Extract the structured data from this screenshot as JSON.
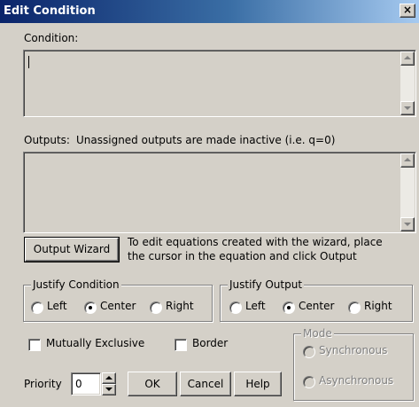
{
  "window": {
    "title": "Edit Condition",
    "close_glyph": "×"
  },
  "condition": {
    "label": "Condition:",
    "value": ""
  },
  "outputs": {
    "label": "Outputs:",
    "note": "Unassigned outputs are made inactive (i.e. q=0)",
    "value": ""
  },
  "wizard": {
    "button_label": "Output Wizard",
    "help_line1": "To edit equations created with the wizard, place",
    "help_line2": "the cursor in the equation and click Output"
  },
  "justify_condition": {
    "legend": "Justify Condition",
    "options": [
      "Left",
      "Center",
      "Right"
    ],
    "selected": "Center"
  },
  "justify_output": {
    "legend": "Justify Output",
    "options": [
      "Left",
      "Center",
      "Right"
    ],
    "selected": "Center"
  },
  "checkboxes": {
    "mutually_exclusive": "Mutually Exclusive",
    "border": "Border"
  },
  "mode": {
    "legend": "Mode",
    "options": [
      "Synchronous",
      "Asynchronous"
    ]
  },
  "priority": {
    "label": "Priority",
    "value": "0"
  },
  "buttons": {
    "ok": "OK",
    "cancel": "Cancel",
    "help": "Help"
  }
}
